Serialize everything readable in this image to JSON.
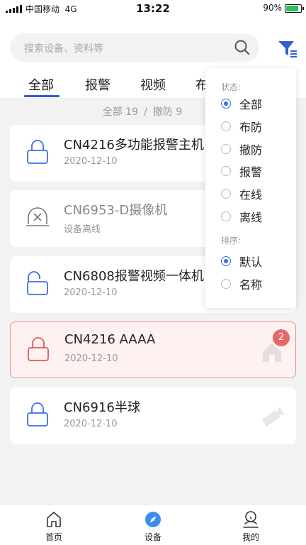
{
  "status_bar": {
    "carrier": "中国移动",
    "network": "4G",
    "time": "13:22",
    "battery": "90%"
  },
  "search": {
    "placeholder": "搜索设备、资料等"
  },
  "tabs": [
    {
      "label": "全部"
    },
    {
      "label": "报警"
    },
    {
      "label": "视频"
    },
    {
      "label": "布"
    }
  ],
  "summary": {
    "all": "全部 19",
    "separator": "/",
    "disarmed": "撤防 9"
  },
  "devices": [
    {
      "name": "CN4216多功能报警主机",
      "sub": "2020-12-10",
      "icon": "lock-closed-icon"
    },
    {
      "name": "CN6953-D摄像机",
      "sub": "设备离线",
      "icon": "camera-offline-icon"
    },
    {
      "name": "CN6808报警视频一体机",
      "sub": "2020-12-10",
      "icon": "lock-open-icon"
    },
    {
      "name": "CN4216 AAAA",
      "sub": "2020-12-10",
      "icon": "lock-closed-alarm-icon",
      "badge": "2"
    },
    {
      "name": "CN6916半球",
      "sub": "2020-12-10",
      "icon": "lock-closed-icon"
    }
  ],
  "filter_menu": {
    "status_label": "状态:",
    "status_options": [
      "全部",
      "布防",
      "撤防",
      "报警",
      "在线",
      "离线"
    ],
    "status_selected": "全部",
    "sort_label": "排序:",
    "sort_options": [
      "默认",
      "名称"
    ],
    "sort_selected": "默认"
  },
  "bottom_nav": [
    {
      "label": "首页",
      "icon": "home-icon"
    },
    {
      "label": "设备",
      "icon": "compass-icon"
    },
    {
      "label": "我的",
      "icon": "user-icon"
    }
  ],
  "colors": {
    "accent": "#2f5fd0",
    "alarm": "#e46a6a",
    "radio": "#3b6ee0"
  }
}
